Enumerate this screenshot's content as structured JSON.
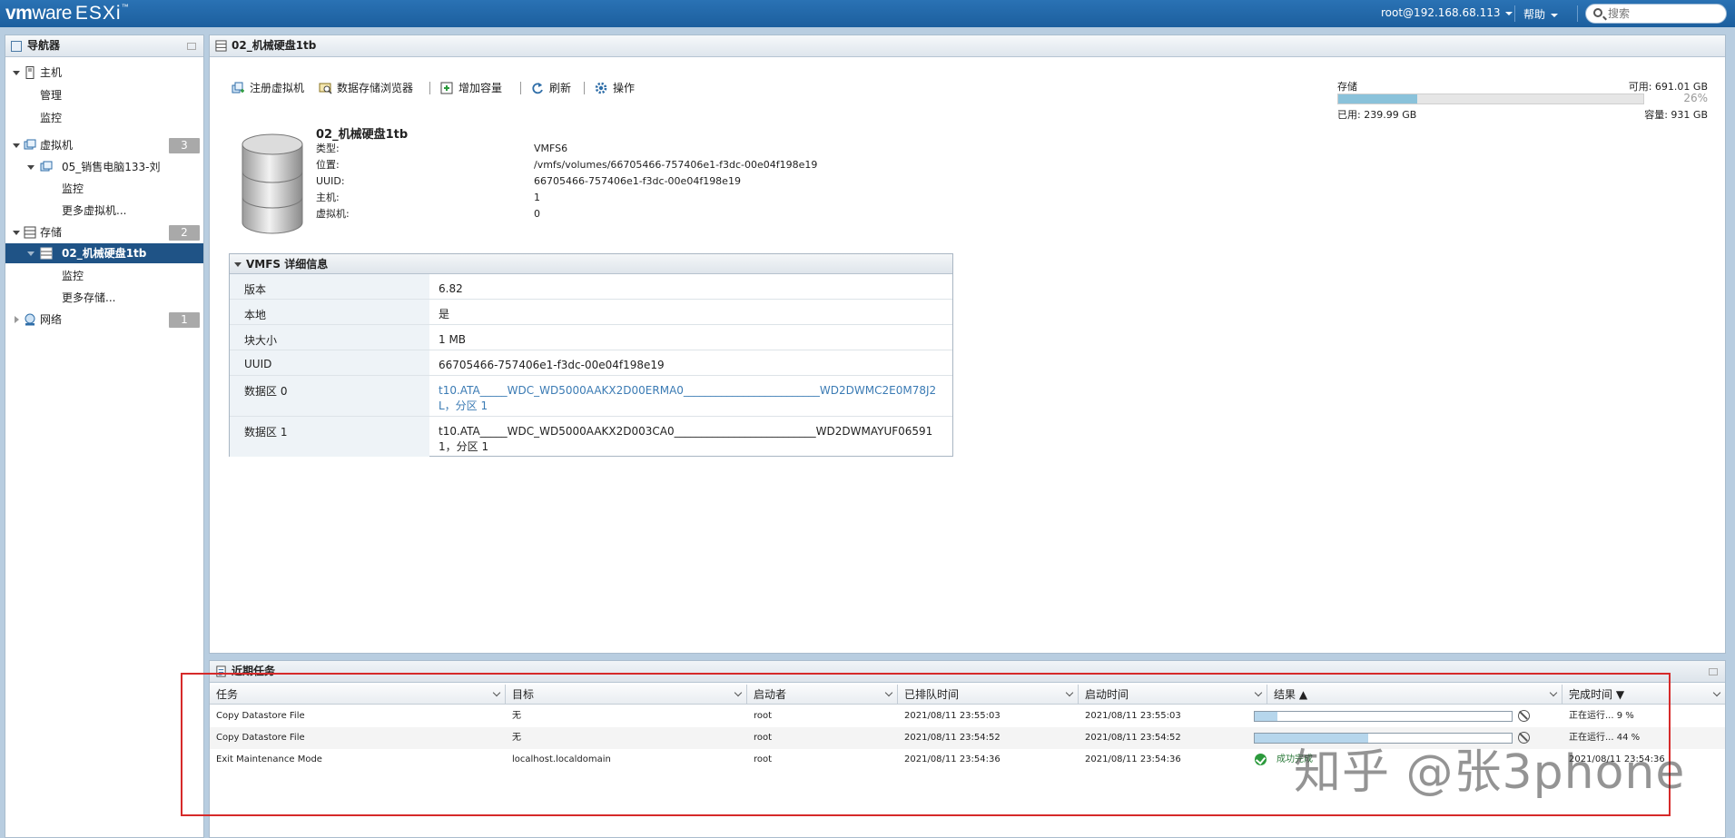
{
  "app": {
    "logo_vm": "vm",
    "logo_ware": "ware",
    "logo_esxi": "ESXi",
    "logo_tm": "™",
    "user": "root@192.168.68.113",
    "help": "帮助",
    "search_placeholder": "搜索"
  },
  "navigator": {
    "title": "导航器",
    "host": "主机",
    "host_manage": "管理",
    "host_monitor": "监控",
    "vms": "虚拟机",
    "vms_count": "3",
    "vm1": "05_销售电脑133-刘",
    "vm1_monitor": "监控",
    "vm_more": "更多虚拟机...",
    "storage": "存储",
    "storage_count": "2",
    "datastore": "02_机械硬盘1tb",
    "datastore_monitor": "监控",
    "storage_more": "更多存储...",
    "network": "网络",
    "network_count": "1"
  },
  "main": {
    "tab_title": "02_机械硬盘1tb",
    "toolbar": {
      "register_vm": "注册虚拟机",
      "browser": "数据存储浏览器",
      "increase": "增加容量",
      "refresh": "刷新",
      "actions": "操作"
    },
    "info": {
      "name": "02_机械硬盘1tb",
      "type_label": "类型:",
      "type_value": "VMFS6",
      "location_label": "位置:",
      "location_value": "/vmfs/volumes/66705466-757406e1-f3dc-00e04f198e19",
      "uuid_label": "UUID:",
      "uuid_value": "66705466-757406e1-f3dc-00e04f198e19",
      "hosts_label": "主机:",
      "hosts_value": "1",
      "vms_label": "虚拟机:",
      "vms_value": "0"
    },
    "storage": {
      "title": "存储",
      "available": "可用: 691.01 GB",
      "percent": "26%",
      "used_fraction": 0.26,
      "used": "已用: 239.99 GB",
      "capacity": "容量: 931 GB"
    },
    "vmfs": {
      "title": "VMFS 详细信息",
      "rows": [
        {
          "key": "版本",
          "value": "6.82"
        },
        {
          "key": "本地",
          "value": "是"
        },
        {
          "key": "块大小",
          "value": "1 MB"
        },
        {
          "key": "UUID",
          "value": "66705466-757406e1-f3dc-00e04f198e19"
        },
        {
          "key": "数据区 0",
          "value": "t10.ATA_____WDC_WD5000AAKX2D00ERMA0_________________________WD2DWMC2E0M78J2L，分区 1"
        },
        {
          "key": "数据区 1",
          "value": "t10.ATA_____WDC_WD5000AAKX2D003CA0__________________________WD2DWMAYUF065911，分区 1"
        }
      ]
    }
  },
  "tasks": {
    "title": "近期任务",
    "columns": [
      "任务",
      "目标",
      "启动者",
      "已排队时间",
      "启动时间",
      "结果 ▲",
      "完成时间 ▼"
    ],
    "rows": [
      {
        "task": "Copy Datastore File",
        "target": "无",
        "initiator": "root",
        "queued": "2021/08/11 23:55:03",
        "started": "2021/08/11 23:55:03",
        "progress": 0.09,
        "completed": "正在运行... 9 %"
      },
      {
        "task": "Copy Datastore File",
        "target": "无",
        "initiator": "root",
        "queued": "2021/08/11 23:54:52",
        "started": "2021/08/11 23:54:52",
        "progress": 0.44,
        "completed": "正在运行... 44 %"
      },
      {
        "task": "Exit Maintenance Mode",
        "target": "localhost.localdomain",
        "initiator": "root",
        "queued": "2021/08/11 23:54:36",
        "started": "2021/08/11 23:54:36",
        "result": "成功完成",
        "completed": "2021/08/11 23:54:36"
      }
    ]
  },
  "watermark": "知乎 @张3phone"
}
